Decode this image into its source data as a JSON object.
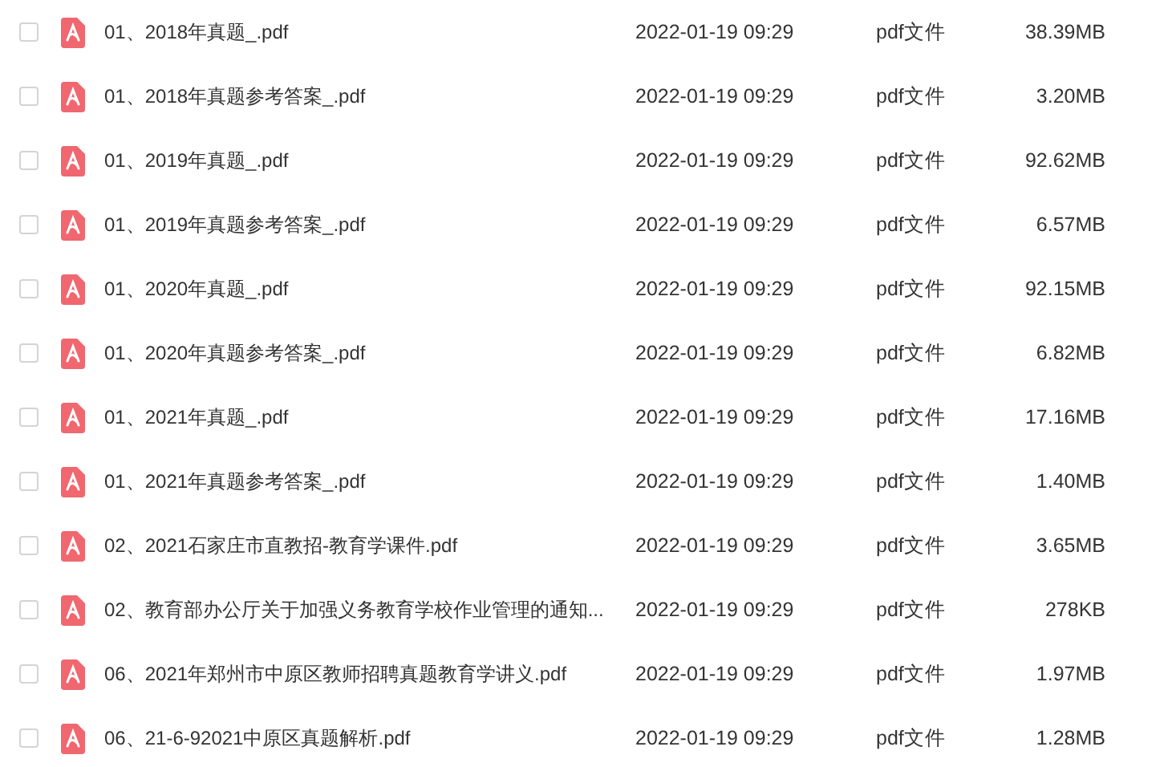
{
  "files": [
    {
      "checked": false,
      "name": "01、2018年真题_.pdf",
      "modified": "2022-01-19 09:29",
      "type": "pdf文件",
      "size": "38.39MB"
    },
    {
      "checked": false,
      "name": "01、2018年真题参考答案_.pdf",
      "modified": "2022-01-19 09:29",
      "type": "pdf文件",
      "size": "3.20MB"
    },
    {
      "checked": false,
      "name": "01、2019年真题_.pdf",
      "modified": "2022-01-19 09:29",
      "type": "pdf文件",
      "size": "92.62MB"
    },
    {
      "checked": false,
      "name": "01、2019年真题参考答案_.pdf",
      "modified": "2022-01-19 09:29",
      "type": "pdf文件",
      "size": "6.57MB"
    },
    {
      "checked": false,
      "name": "01、2020年真题_.pdf",
      "modified": "2022-01-19 09:29",
      "type": "pdf文件",
      "size": "92.15MB"
    },
    {
      "checked": false,
      "name": "01、2020年真题参考答案_.pdf",
      "modified": "2022-01-19 09:29",
      "type": "pdf文件",
      "size": "6.82MB"
    },
    {
      "checked": false,
      "name": "01、2021年真题_.pdf",
      "modified": "2022-01-19 09:29",
      "type": "pdf文件",
      "size": "17.16MB"
    },
    {
      "checked": false,
      "name": "01、2021年真题参考答案_.pdf",
      "modified": "2022-01-19 09:29",
      "type": "pdf文件",
      "size": "1.40MB"
    },
    {
      "checked": false,
      "name": "02、2021石家庄市直教招-教育学课件.pdf",
      "modified": "2022-01-19 09:29",
      "type": "pdf文件",
      "size": "3.65MB"
    },
    {
      "checked": false,
      "name": "02、教育部办公厅关于加强义务教育学校作业管理的通知...",
      "modified": "2022-01-19 09:29",
      "type": "pdf文件",
      "size": "278KB"
    },
    {
      "checked": false,
      "name": "06、2021年郑州市中原区教师招聘真题教育学讲义.pdf",
      "modified": "2022-01-19 09:29",
      "type": "pdf文件",
      "size": "1.97MB"
    },
    {
      "checked": false,
      "name": "06、21-6-92021中原区真题解析.pdf",
      "modified": "2022-01-19 09:29",
      "type": "pdf文件",
      "size": "1.28MB"
    }
  ]
}
